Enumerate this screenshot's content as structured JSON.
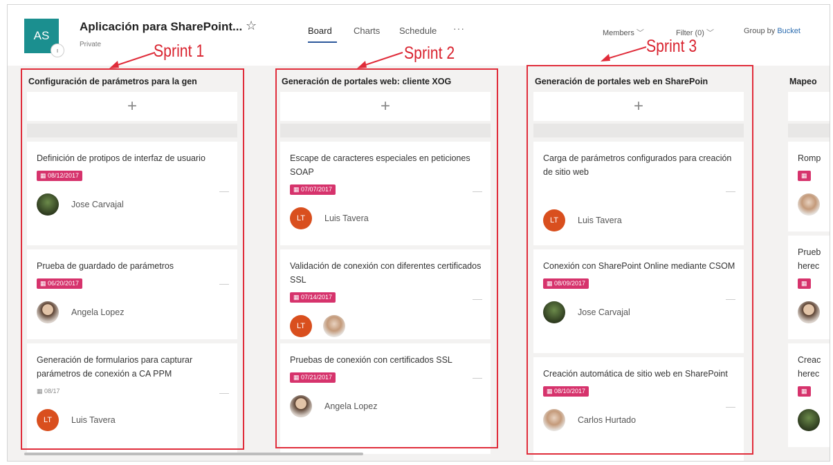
{
  "header": {
    "avatar_initials": "AS",
    "plan_title": "Aplicación para SharePoint...",
    "privacy": "Private",
    "tabs": [
      "Board",
      "Charts",
      "Schedule"
    ],
    "more": "···",
    "members": "Members",
    "filter": "Filter (0)",
    "group_by_label": "Group by",
    "group_by_value": "Bucket"
  },
  "annotations": [
    "Sprint 1",
    "Sprint 2",
    "Sprint 3"
  ],
  "add_symbol": "+",
  "buckets": [
    {
      "title": "Configuración de parámetros para la gen",
      "tasks": [
        {
          "title": "Definición de protipos de interfaz de usuario",
          "due": "08/12/2017",
          "assignee": "Jose Carvajal"
        },
        {
          "title": "Prueba de guardado de parámetros",
          "due": "06/20/2017",
          "assignee": "Angela Lopez"
        },
        {
          "title": "Generación de formularios para capturar parámetros de conexión a CA PPM",
          "due": "08/17",
          "assignee": "Luis Tavera",
          "initials": "LT"
        }
      ]
    },
    {
      "title": "Generación de portales web: cliente XOG",
      "tasks": [
        {
          "title": "Escape de caracteres especiales en peticiones SOAP",
          "due": "07/07/2017",
          "assignee": "Luis Tavera",
          "initials": "LT"
        },
        {
          "title": "Validación de conexión con diferentes certificados SSL",
          "due": "07/14/2017",
          "initials": "LT"
        },
        {
          "title": "Pruebas de conexión con certificados SSL",
          "due": "07/21/2017",
          "assignee": "Angela Lopez"
        }
      ]
    },
    {
      "title": "Generación de portales web en SharePoin",
      "tasks": [
        {
          "title": "Carga de parámetros configurados para creación de sitio web",
          "assignee": "Luis Tavera",
          "initials": "LT"
        },
        {
          "title": "Conexión con SharePoint Online mediante CSOM",
          "due": "08/09/2017",
          "assignee": "Jose Carvajal"
        },
        {
          "title": "Creación automática de sitio web en SharePoint",
          "due": "08/10/2017",
          "assignee": "Carlos Hurtado"
        }
      ]
    },
    {
      "title": "Mapeo",
      "tasks": [
        {
          "title": "Romp"
        },
        {
          "title": "Prueb",
          "title2": "herec"
        },
        {
          "title": "Creac",
          "title2": "herec"
        }
      ]
    }
  ]
}
